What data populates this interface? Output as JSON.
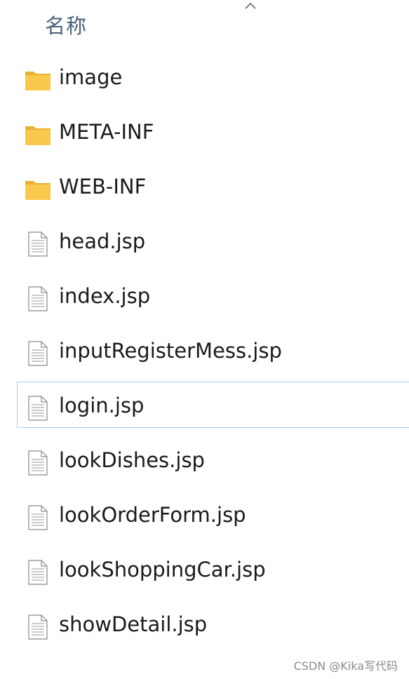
{
  "header": {
    "column_name": "名称",
    "sort_icon": "chevron-up-icon"
  },
  "files": [
    {
      "name": "image",
      "type": "folder",
      "icon": "folder-icon"
    },
    {
      "name": "META-INF",
      "type": "folder",
      "icon": "folder-icon"
    },
    {
      "name": "WEB-INF",
      "type": "folder",
      "icon": "folder-icon"
    },
    {
      "name": "head.jsp",
      "type": "file",
      "icon": "document-icon"
    },
    {
      "name": "index.jsp",
      "type": "file",
      "icon": "document-icon"
    },
    {
      "name": "inputRegisterMess.jsp",
      "type": "file",
      "icon": "document-icon"
    },
    {
      "name": "login.jsp",
      "type": "file",
      "icon": "document-icon",
      "selected": true
    },
    {
      "name": "lookDishes.jsp",
      "type": "file",
      "icon": "document-icon"
    },
    {
      "name": "lookOrderForm.jsp",
      "type": "file",
      "icon": "document-icon"
    },
    {
      "name": "lookShoppingCar.jsp",
      "type": "file",
      "icon": "document-icon"
    },
    {
      "name": "showDetail.jsp",
      "type": "file",
      "icon": "document-icon"
    }
  ],
  "watermark": "CSDN @Kika写代码",
  "colors": {
    "folder": "#f8c94d",
    "folder_dark": "#e8b12f",
    "header_text": "#4c607a",
    "selection_border": "#9fd3f0"
  }
}
